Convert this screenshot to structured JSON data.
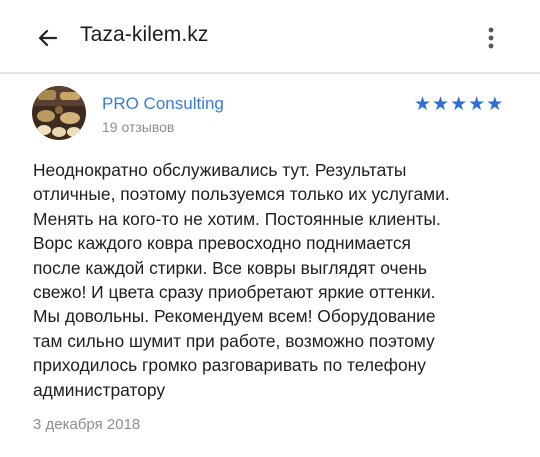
{
  "header": {
    "back_icon": "arrow-left-icon",
    "title": "Taza-kilem.kz",
    "menu_icon": "more-vertical-icon"
  },
  "review": {
    "author": {
      "name": "PRO Consulting",
      "reviews_count": "19 отзывов",
      "avatar_icon": "avatar-photo"
    },
    "rating": 5,
    "rating_max": 5,
    "star_glyph": "★",
    "text": "Неоднократно обслуживались тут. Результаты\nотличные, поэтому пользуемся только их услугами.\nМенять на кого-то не хотим. Постоянные клиенты.\nВорс каждого ковра превосходно поднимается\nпосле каждой стирки. Все ковры выглядят очень\nсвежо! И цвета сразу приобретают яркие оттенки.\nМы довольны. Рекомендуем всем! Оборудование\nтам сильно шумит при работе, возможно поэтому\nприходилось громко разговаривать по телефону\nадминистратору",
    "date": "3 декабря 2018"
  },
  "colors": {
    "accent": "#3a7bd5",
    "star": "#2f6fd4",
    "muted": "#8e8e8e",
    "text": "#1e1e1e"
  }
}
